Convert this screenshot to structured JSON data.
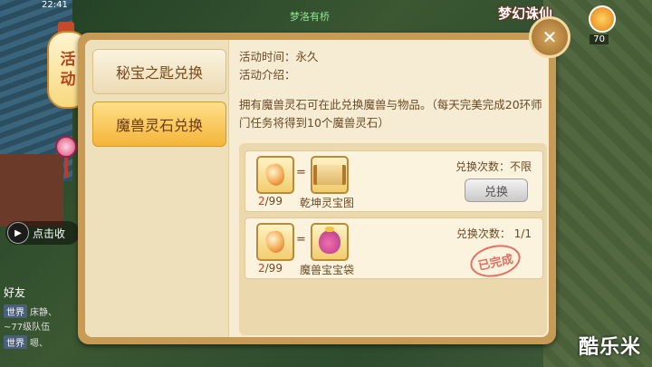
{
  "hud": {
    "time": "22:41",
    "player_name": "梦洛有桥",
    "logo_text": "梦幻诛仙",
    "level": "70",
    "chat_toggle": "点击收",
    "friends": "好友",
    "chat_lines": [
      {
        "tag": "世界",
        "text": "床静、"
      },
      {
        "tag": "",
        "text": "~77级队伍"
      },
      {
        "tag": "世界",
        "text": "嗯、"
      }
    ],
    "watermark": "酷乐米"
  },
  "activity_tab": {
    "label_line1": "活",
    "label_line2": "动"
  },
  "sidebar": {
    "tabs": [
      {
        "label": "秘宝之匙兑换",
        "active": false
      },
      {
        "label": "魔兽灵石兑换",
        "active": true
      }
    ]
  },
  "info": {
    "time_label": "活动时间：永久",
    "intro_label": "活动介绍：",
    "description": "拥有魔兽灵石可在此兑换魔兽与物品。（每天完美完成20环师门任务将得到10个魔兽灵石）"
  },
  "exchanges": [
    {
      "cost_have": "2",
      "cost_total": "/99",
      "equals": "=",
      "reward_name": "乾坤灵宝图",
      "count_label": "兑换次数：不限",
      "button_label": "兑换",
      "completed": false
    },
    {
      "cost_have": "2",
      "cost_total": "/99",
      "equals": "=",
      "reward_name": "魔兽宝宝袋",
      "count_label": "兑换次数： 1/1",
      "stamp_label": "已完成",
      "completed": true
    }
  ],
  "icons": {
    "close": "close-icon",
    "cost_item": "spirit-stone-icon",
    "reward_1": "treasure-map-scroll-icon",
    "reward_2": "beast-pouch-icon"
  }
}
